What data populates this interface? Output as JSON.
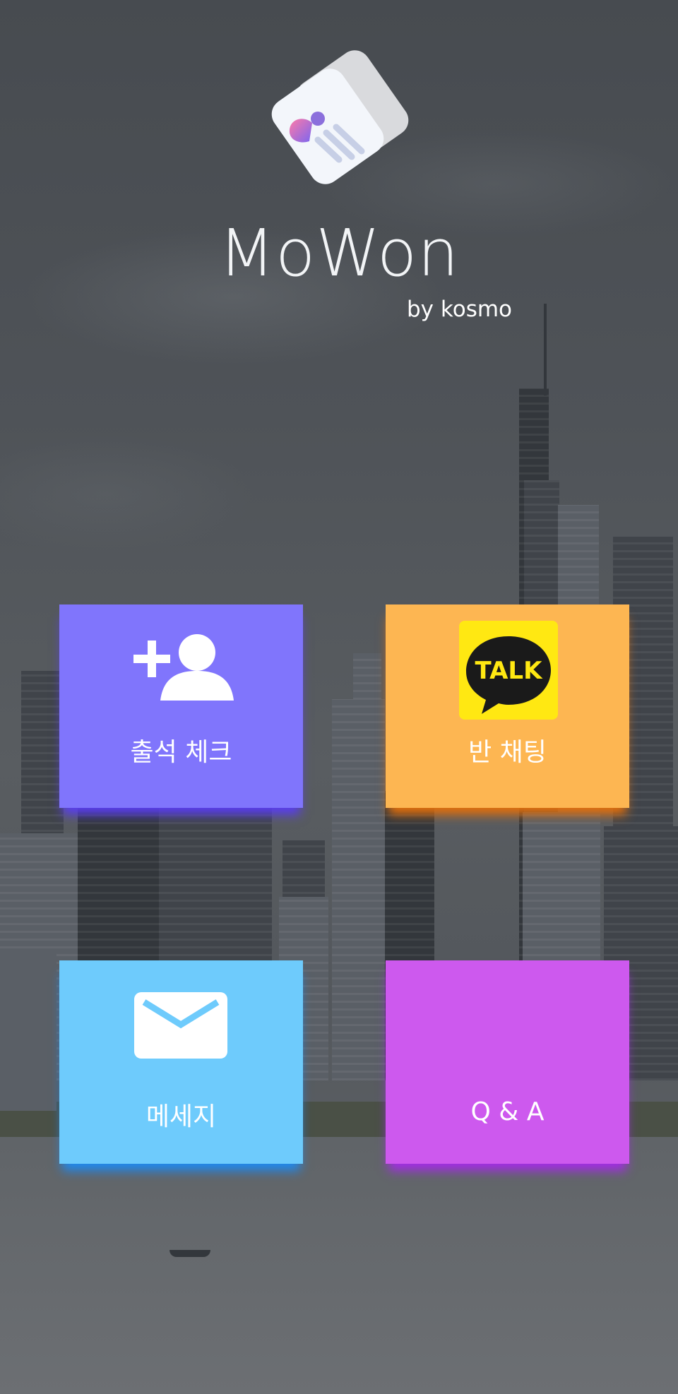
{
  "app": {
    "name": "MoWon",
    "subtitle": "by kosmo"
  },
  "tiles": [
    {
      "label": "출석 체크",
      "icon": "add-user-icon",
      "color": "#8075fc"
    },
    {
      "label": "반 채팅",
      "icon": "kakaotalk-icon",
      "icon_text": "TALK",
      "color": "#fdb652"
    },
    {
      "label": "메세지",
      "icon": "envelope-icon",
      "color": "#6ecbfc"
    },
    {
      "label": "Q & A",
      "icon": "",
      "color": "#cd59ee"
    }
  ]
}
